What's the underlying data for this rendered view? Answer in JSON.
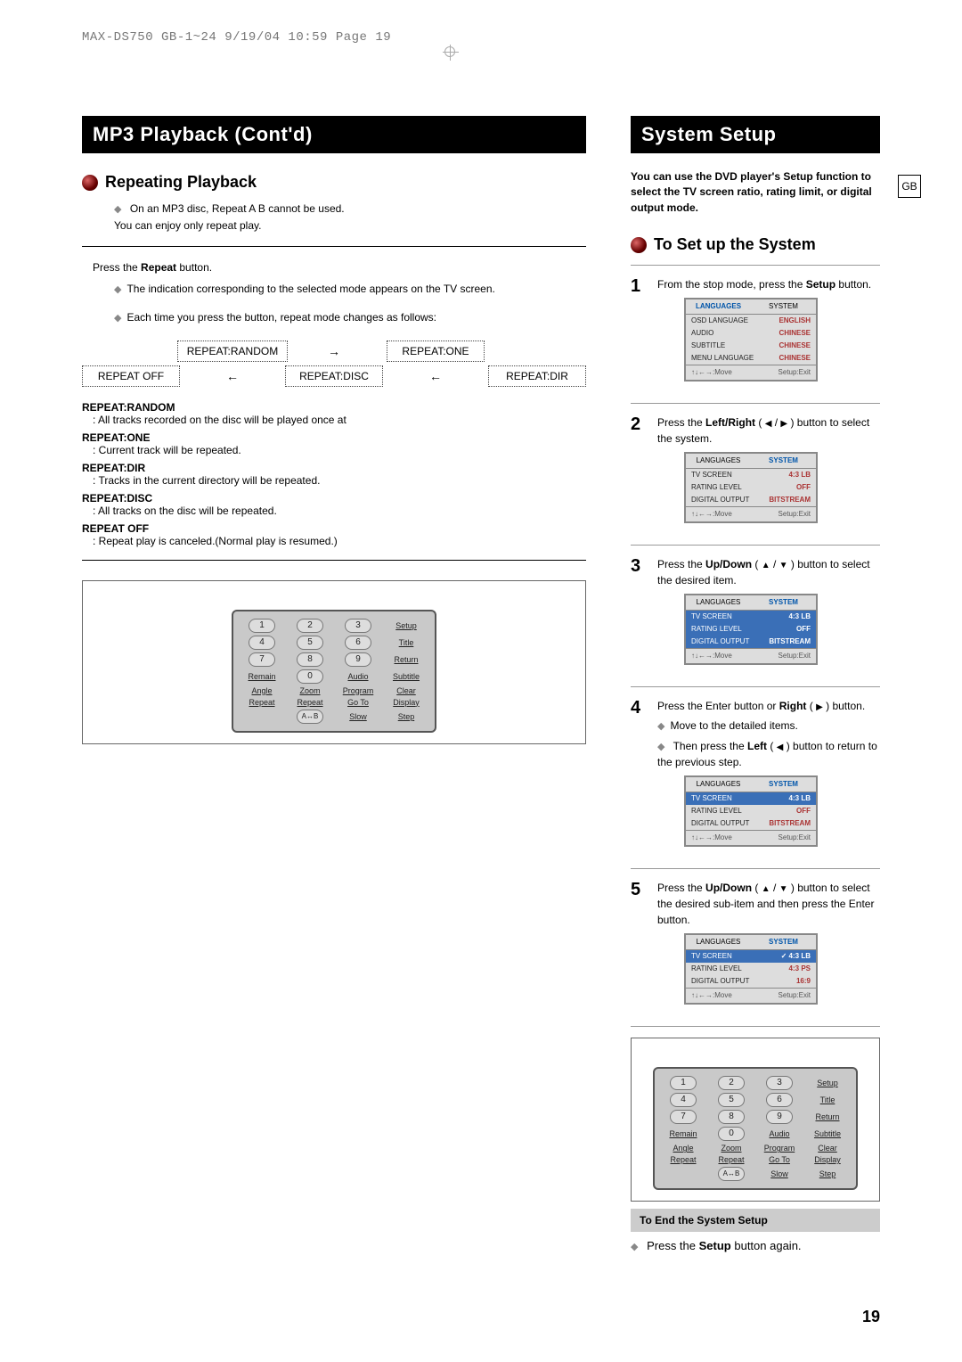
{
  "header": "MAX-DS750 GB-1~24  9/19/04 10:59  Page 19",
  "gb_tab": "GB",
  "page_number": "19",
  "left": {
    "bar": "MP3 Playback (Cont'd)",
    "section": "Repeating Playback",
    "bul1": "On an MP3 disc, Repeat A    B cannot be used.",
    "bul1b": "You can enjoy only repeat play.",
    "press_repeat_pre": "Press the ",
    "press_repeat_bold": "Repeat",
    "press_repeat_post": " button.",
    "ind1": "The indication corresponding to the selected mode appears on the TV screen.",
    "ind2": "Each time you press the button, repeat mode changes as follows:",
    "flow": {
      "random": "REPEAT:RANDOM",
      "one": "REPEAT:ONE",
      "off": "REPEAT OFF",
      "disc": "REPEAT:DISC",
      "dir": "REPEAT:DIR"
    },
    "defs": {
      "random_t": "REPEAT:RANDOM",
      "random_d": ": All tracks recorded on the disc will be played once at",
      "one_t": "REPEAT:ONE",
      "one_d": ": Current track will be repeated.",
      "dir_t": "REPEAT:DIR",
      "dir_d": ": Tracks in the current directory will be repeated.",
      "disc_t": "REPEAT:DISC",
      "disc_d": ": All tracks on the disc will be repeated.",
      "off_t": "REPEAT OFF",
      "off_d": ": Repeat play is canceled.(Normal play is resumed.)"
    }
  },
  "right": {
    "bar": "System Setup",
    "intro": "You can use the DVD player's Setup function to select the TV screen ratio, rating limit, or digital output mode.",
    "section": "To Set up the System",
    "s1_pre": "From the stop mode, press the ",
    "s1_bold": "Setup",
    "s1_post": " button.",
    "s2_pre": "Press the ",
    "s2_bold": "Left/Right",
    "s2_post": " button to select the system.",
    "s3_pre": "Press the ",
    "s3_bold": "Up/Down",
    "s3_post": " button to select the desired item.",
    "s4_pre": "Press the Enter button or ",
    "s4_bold": "Right",
    "s4_post": " button.",
    "s4a": "Move to the detailed items.",
    "s4b_pre": "Then press the ",
    "s4b_bold": "Left",
    "s4b_post": " button to return to the previous step.",
    "s5_pre": "Press the ",
    "s5_bold": "Up/Down",
    "s5_post": " button to select the desired sub-item and then press the Enter button.",
    "end_band": "To End the System Setup",
    "end_pre": "Press the ",
    "end_bold": "Setup",
    "end_post": " button again."
  },
  "screens": {
    "tab_lang": "LANGUAGES",
    "tab_sys": "SYSTEM",
    "lang_rows": [
      [
        "OSD LANGUAGE",
        "ENGLISH"
      ],
      [
        "AUDIO",
        "CHINESE"
      ],
      [
        "SUBTITLE",
        "CHINESE"
      ],
      [
        "MENU LANGUAGE",
        "CHINESE"
      ]
    ],
    "sys_rows": [
      [
        "TV SCREEN",
        "4:3 LB"
      ],
      [
        "RATING LEVEL",
        "OFF"
      ],
      [
        "DIGITAL OUTPUT",
        "BITSTREAM"
      ]
    ],
    "sys_rows5": [
      [
        "TV SCREEN",
        "✓ 4:3 LB"
      ],
      [
        "RATING LEVEL",
        "4:3 PS"
      ],
      [
        "DIGITAL OUTPUT",
        "16:9"
      ]
    ],
    "foot_l": "↑↓←→:Move",
    "foot_r": "Setup:Exit"
  },
  "remote": {
    "nums": [
      "1",
      "2",
      "3",
      "4",
      "5",
      "6",
      "7",
      "8",
      "9",
      "0"
    ],
    "labels": [
      "Setup",
      "Title",
      "Return",
      "Remain",
      "Audio",
      "Subtitle",
      "Angle",
      "Zoom",
      "Program",
      "Clear",
      "Repeat",
      "Repeat",
      "Go To",
      "Display",
      "A↔B",
      "Slow",
      "Step"
    ]
  }
}
